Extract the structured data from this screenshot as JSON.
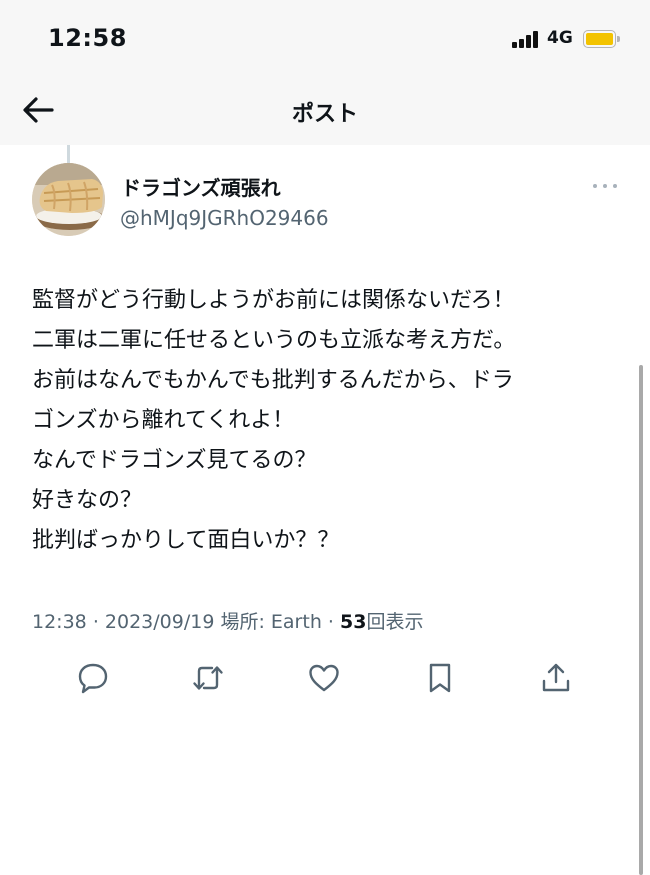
{
  "status_bar": {
    "time": "12:58",
    "network": "4G",
    "battery_color": "#f3c300"
  },
  "nav": {
    "title": "ポスト",
    "back_icon": "arrow-left-icon"
  },
  "author": {
    "display_name": "ドラゴンズ頑張れ",
    "handle": "@hMJq9JGRhO29466",
    "avatar": "food-photo-avatar"
  },
  "tweet": {
    "lines": [
      "監督がどう行動しようがお前には関係ないだろ！",
      "二軍は二軍に任せるというのも立派な考え方だ。",
      "お前はなんでもかんでも批判するんだから、ドラ",
      "ゴンズから離れてくれよ！",
      "なんでドラゴンズ見てるの？",
      "好きなの？",
      "批判ばっかりして面白いか？？"
    ]
  },
  "meta": {
    "time": "12:38",
    "separator": "·",
    "date": "2023/09/19",
    "location_label": "場所: Earth",
    "views_count": "53",
    "views_label": "回表示"
  },
  "actions": [
    "reply-icon",
    "retweet-icon",
    "like-icon",
    "bookmark-icon",
    "share-icon"
  ]
}
